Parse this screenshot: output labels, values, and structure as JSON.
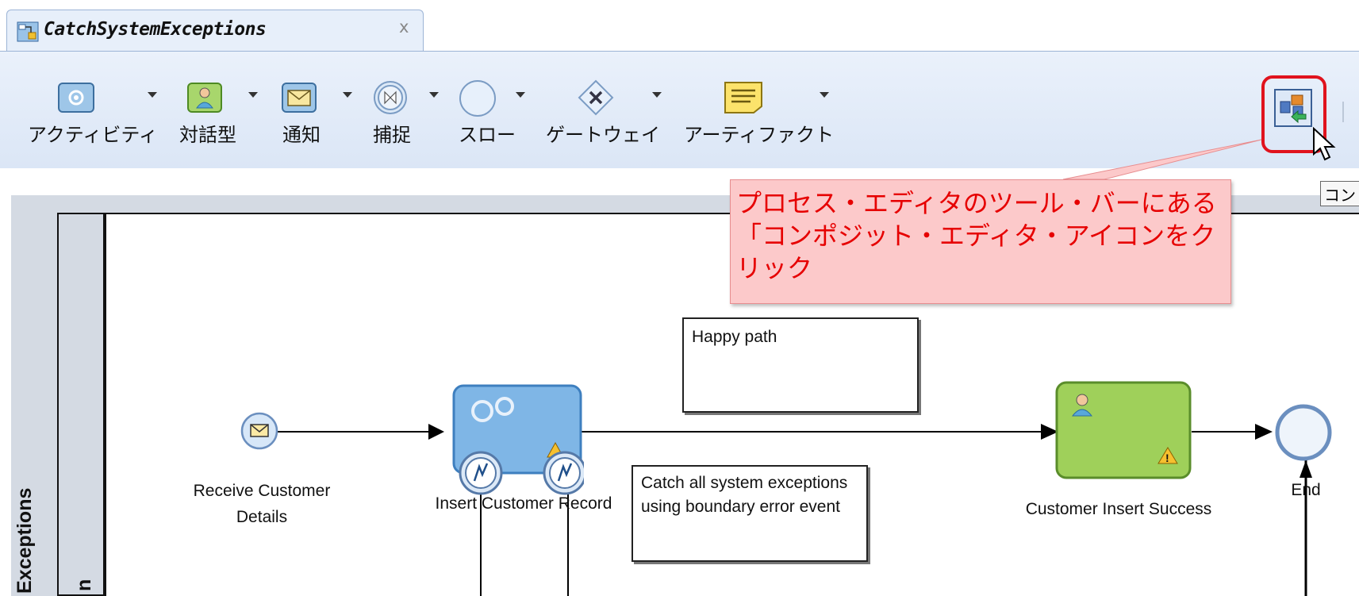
{
  "tab": {
    "title": "CatchSystemExceptions",
    "close": "x"
  },
  "toolbar": {
    "items": [
      {
        "label": "アクティビティ",
        "icon": "gear-activity-icon"
      },
      {
        "label": "対話型",
        "icon": "user-task-icon"
      },
      {
        "label": "通知",
        "icon": "envelope-notify-icon"
      },
      {
        "label": "捕捉",
        "icon": "catch-event-icon"
      },
      {
        "label": "スロー",
        "icon": "throw-event-icon"
      },
      {
        "label": "ゲートウェイ",
        "icon": "gateway-icon"
      },
      {
        "label": "アーティファクト",
        "icon": "artifact-note-icon"
      }
    ],
    "composite_editor_icon": "composite-editor-icon",
    "tooltip": "コン"
  },
  "callout": {
    "text": "プロセス・エディタのツール・バーにある「コンポジット・エディタ・アイコンをクリック",
    "color": "#e60000",
    "background": "#fcc9ca"
  },
  "diagram": {
    "pool_label": "Exceptions",
    "lane_label": "n",
    "start_event_label": "Receive Customer Details",
    "task_label": "Insert Customer Record",
    "user_task_label": "Customer Insert Success",
    "end_label": "End",
    "note_happy": "Happy path",
    "note_catch": "Catch all system exceptions using boundary error event"
  }
}
